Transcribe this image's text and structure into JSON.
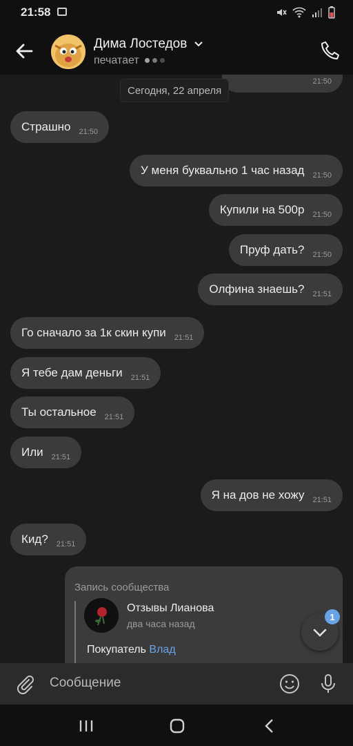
{
  "status_bar": {
    "time": "21:58"
  },
  "header": {
    "contact_name": "Дима Лостедов",
    "status": "печатает",
    "icons": [
      "back-arrow-icon",
      "chevron-down-icon",
      "phone-icon"
    ]
  },
  "chat": {
    "date": "Сегодня, 22 апреля",
    "messages": [
      {
        "side": "out",
        "text": "",
        "time": "21:50"
      },
      {
        "side": "in",
        "text": "Страшно",
        "time": "21:50"
      },
      {
        "side": "out",
        "text": "У меня буквально 1 час назад",
        "time": "21:50"
      },
      {
        "side": "out",
        "text": "Купили на 500р",
        "time": "21:50"
      },
      {
        "side": "out",
        "text": "Пруф дать?",
        "time": "21:50"
      },
      {
        "side": "out",
        "text": "Олфина знаешь?",
        "time": "21:51"
      },
      {
        "side": "in",
        "text": "Го сначало за 1к скин купи",
        "time": "21:51"
      },
      {
        "side": "in",
        "text": "Я тебе дам деньги",
        "time": "21:51"
      },
      {
        "side": "in",
        "text": "Ты остальное",
        "time": "21:51"
      },
      {
        "side": "in",
        "text": "Или",
        "time": "21:51"
      },
      {
        "side": "out",
        "text": "Я на дов не хожу",
        "time": "21:51"
      },
      {
        "side": "in",
        "text": "Кид?",
        "time": "21:51"
      }
    ],
    "post": {
      "title": "Запись сообщества",
      "author": "Отзывы Лианова",
      "ago": "два часа назад",
      "body_prefix": "Покупатель ",
      "body_link": "Влад"
    },
    "unread_badge": "1"
  },
  "composer": {
    "placeholder": "Сообщение"
  },
  "nav": {
    "icons": [
      "recent-apps-icon",
      "home-icon",
      "back-icon"
    ]
  },
  "colors": {
    "bubble": "#3b3b3b",
    "background": "#1b1b1b",
    "accent": "#6aa2e6"
  }
}
